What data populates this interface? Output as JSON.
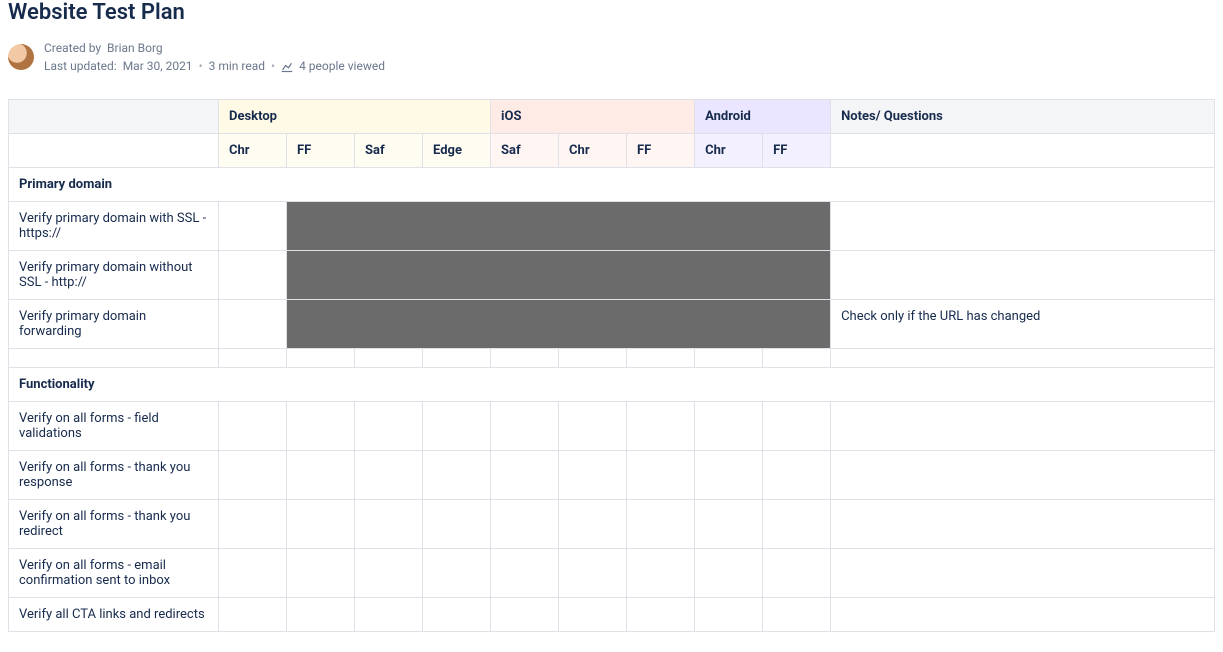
{
  "title": "Website Test Plan",
  "byline": {
    "created_by_prefix": "Created by",
    "author": "Brian Borg",
    "last_updated_prefix": "Last updated:",
    "last_updated": "Mar 30, 2021",
    "read_time": "3 min read",
    "viewers": "4 people viewed"
  },
  "platforms": {
    "desktop": "Desktop",
    "ios": "iOS",
    "android": "Android",
    "notes": "Notes/ Questions"
  },
  "browsers": {
    "desktop": [
      "Chr",
      "FF",
      "Saf",
      "Edge"
    ],
    "ios": [
      "Saf",
      "Chr",
      "FF"
    ],
    "android": [
      "Chr",
      "FF"
    ]
  },
  "sections": [
    {
      "title": "Primary domain",
      "rows": [
        {
          "label": "Verify primary domain with SSL - https://",
          "shaded": true,
          "notes": ""
        },
        {
          "label": "Verify primary domain without SSL - http://",
          "shaded": true,
          "notes": ""
        },
        {
          "label": "Verify primary domain forwarding",
          "shaded": true,
          "notes": "Check only if the URL has changed"
        },
        {
          "label": "",
          "shaded": false,
          "notes": ""
        }
      ]
    },
    {
      "title": "Functionality",
      "rows": [
        {
          "label": "Verify on all forms - field validations",
          "shaded": false,
          "notes": ""
        },
        {
          "label": "Verify on all forms - thank you response",
          "shaded": false,
          "notes": ""
        },
        {
          "label": "Verify on all forms - thank you redirect",
          "shaded": false,
          "notes": ""
        },
        {
          "label": "Verify on all forms - email confirmation sent to inbox",
          "shaded": false,
          "notes": ""
        },
        {
          "label": "Verify all CTA links and redirects",
          "shaded": false,
          "notes": ""
        }
      ]
    }
  ]
}
